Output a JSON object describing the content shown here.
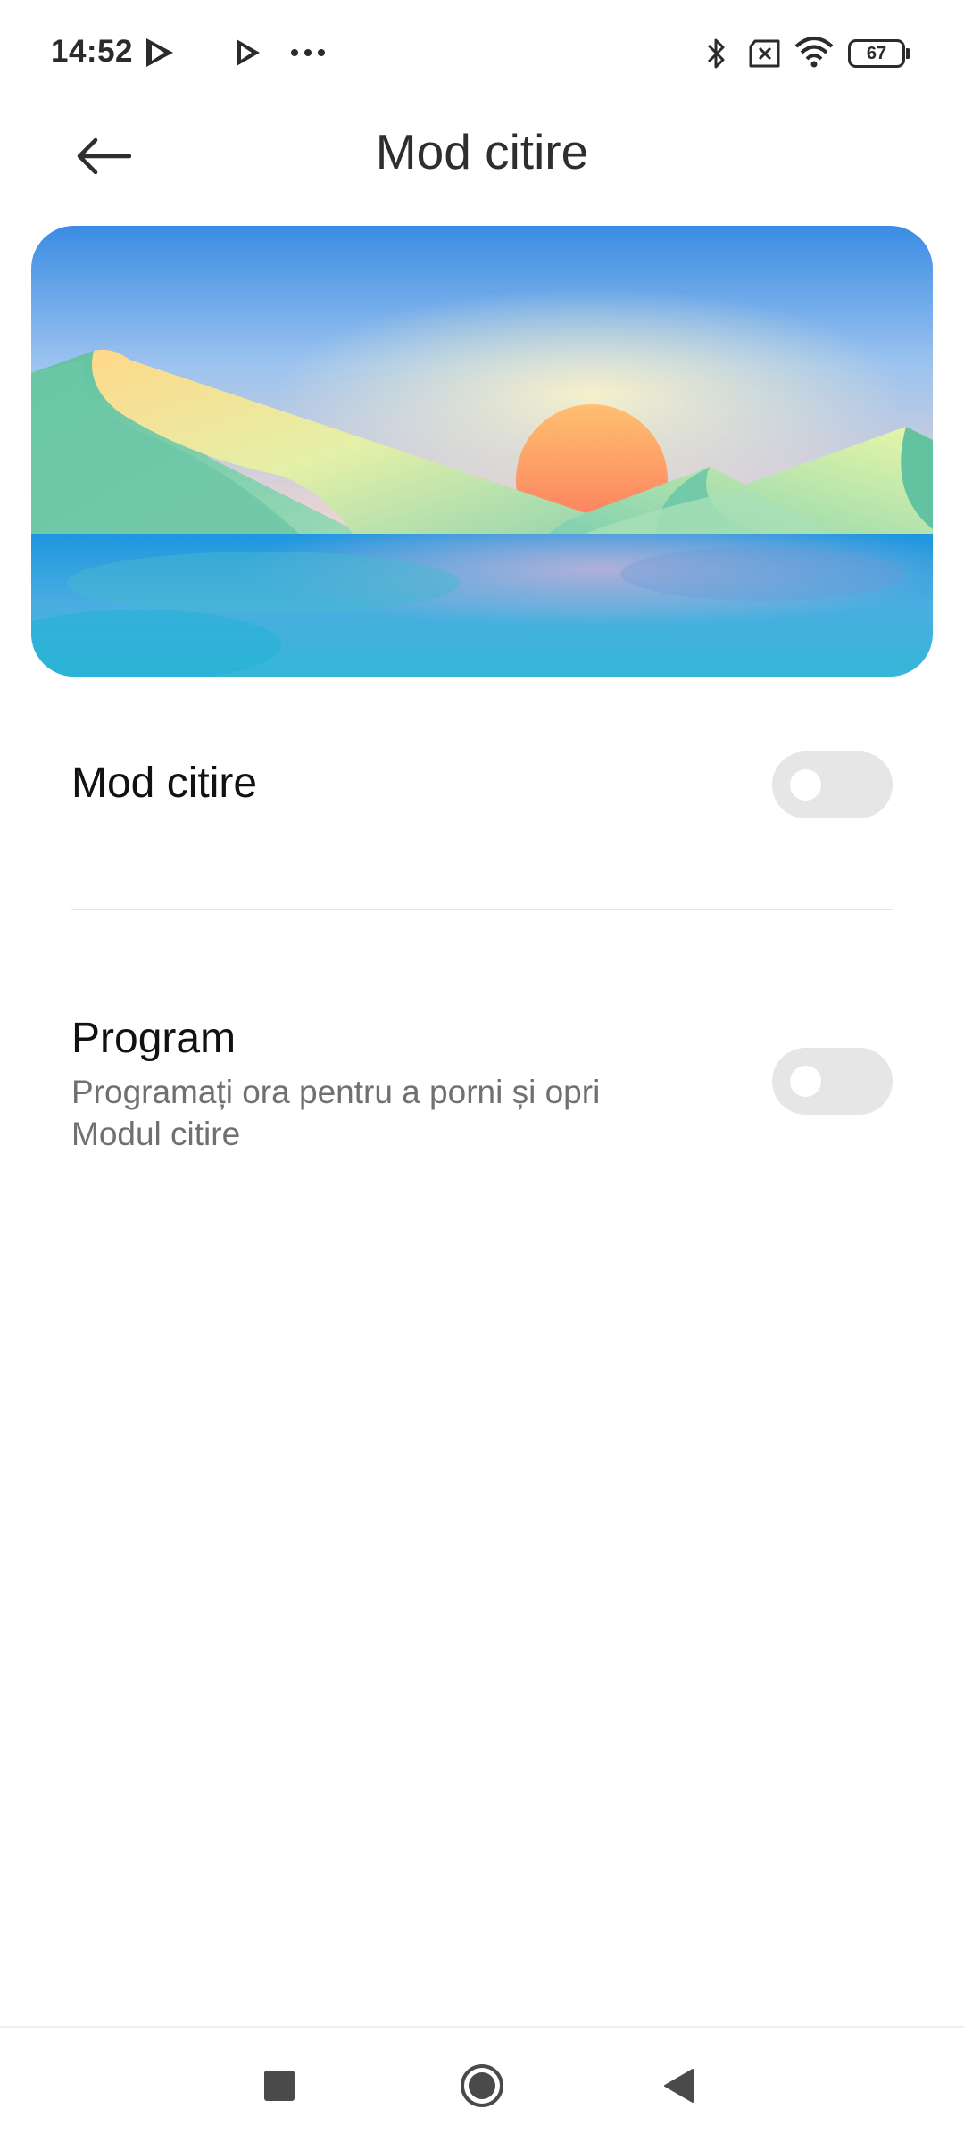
{
  "status_bar": {
    "time": "14:52",
    "battery": "67",
    "icons": [
      "play-store-icon",
      "play-store-icon",
      "more-dots-icon",
      "bluetooth-icon",
      "no-sim-icon",
      "wifi-icon",
      "battery-icon"
    ]
  },
  "header": {
    "title": "Mod citire",
    "back_icon": "arrow-left-icon"
  },
  "settings": {
    "reading_mode": {
      "title": "Mod citire",
      "enabled": false
    },
    "schedule": {
      "title": "Program",
      "subtitle": "Programați ora pentru a porni și opri Modul citire",
      "enabled": false
    }
  },
  "nav_bar": {
    "icons": [
      "recents-square-icon",
      "home-circle-icon",
      "back-triangle-icon"
    ]
  },
  "colors": {
    "toggle_off": "#e6e6e6",
    "title_text": "#2e2e2e",
    "subtitle_text": "#707070"
  }
}
